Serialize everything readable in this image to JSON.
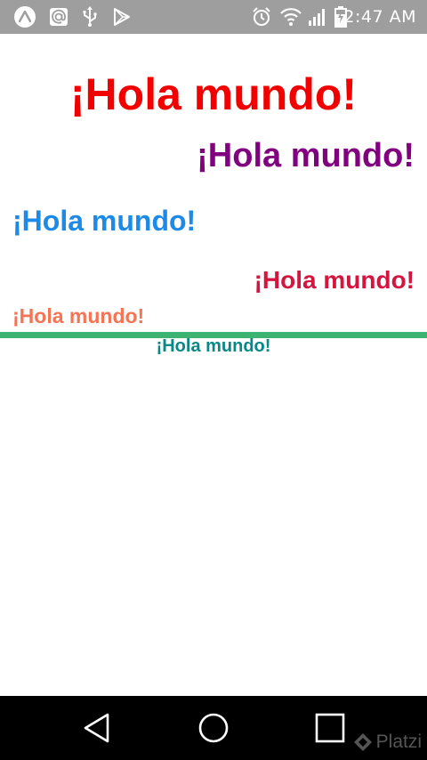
{
  "status_bar": {
    "time": "2:47 AM",
    "left_icons": [
      "expo-icon",
      "at-sign-icon",
      "usb-icon",
      "play-store-icon"
    ],
    "right_icons": [
      "alarm-icon",
      "wifi-icon",
      "signal-icon",
      "battery-icon"
    ]
  },
  "headings": [
    {
      "text": "¡Hola mundo!",
      "color": "#f20000"
    },
    {
      "text": "¡Hola mundo!",
      "color": "#800080"
    },
    {
      "text": "¡Hola mundo!",
      "color": "#1e8ae8"
    },
    {
      "text": "¡Hola mundo!",
      "color": "#d4153f"
    },
    {
      "text": "¡Hola mundo!",
      "color": "#f47454"
    },
    {
      "text": "¡Hola mundo!",
      "color": "#0a8787"
    }
  ],
  "divider_color": "#3cb371",
  "nav_bar": {
    "buttons": [
      "back-icon",
      "home-icon",
      "recents-icon"
    ]
  },
  "watermark": {
    "text": "Platzi"
  }
}
